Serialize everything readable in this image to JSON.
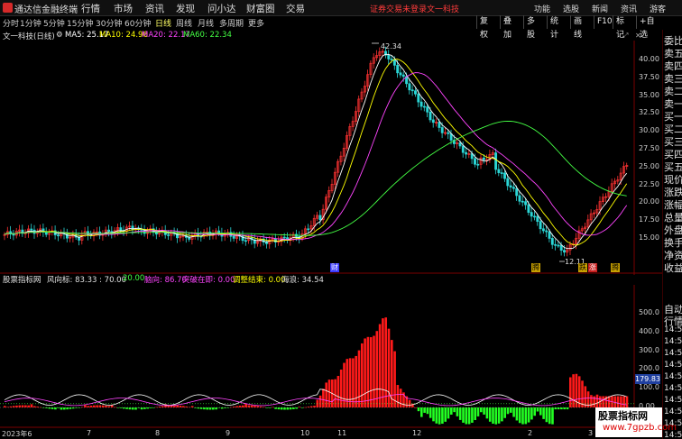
{
  "app": {
    "name": "通达信金融终端",
    "menus": [
      "行情",
      "市场",
      "资讯",
      "发现",
      "问小达",
      "财富圈",
      "交易"
    ],
    "warning": "证券交易未登录",
    "stock_title": "文一科技",
    "right_menus": [
      "功能",
      "选股",
      "新闻",
      "资讯",
      "游客"
    ]
  },
  "periods": {
    "items": [
      "分时",
      "1分钟",
      "5分钟",
      "15分钟",
      "30分钟",
      "60分钟",
      "日线",
      "周线",
      "月线",
      "多周期",
      "更多"
    ],
    "active": "日线"
  },
  "toolbar": {
    "buttons": [
      "复权",
      "叠加",
      "多股",
      "统计",
      "画线",
      "F10",
      "标记",
      "+自选"
    ]
  },
  "info": {
    "stock": "文一科技(日线)",
    "ma5": "MA5: 25.17",
    "ma10": "MA10: 24.96",
    "ma20": "MA20: 22.17",
    "ma60": "MA60: 22.34"
  },
  "price_axis": [
    "40.00",
    "37.50",
    "35.00",
    "32.50",
    "30.00",
    "27.50",
    "25.00",
    "22.50",
    "20.00",
    "17.50",
    "15.00"
  ],
  "annotations": {
    "high": "42.34",
    "low": "12.11",
    "tag_cai": "财",
    "tag_ju": "腾",
    "tag_tuo": "跌",
    "tag_zhang": "涨",
    "tag_teng": "腾"
  },
  "indicator": {
    "name": "股票指标网",
    "fengxiang": "风向标: 83.33 : 70.00",
    "v20": "20.00",
    "ling": "脑向: 86.70",
    "tupo": "突破在即: 0.00",
    "tiaozheng": "调整结束: 0.00",
    "hailang": "海浪: 34.54"
  },
  "ind_axis": [
    "500.0",
    "400.0",
    "300.0",
    "200.0",
    "100.0",
    "0.00"
  ],
  "current_value": "179.83",
  "x_axis": [
    "2023年6",
    "7",
    "8",
    "9",
    "10",
    "11",
    "12",
    "2",
    "3"
  ],
  "right_panel": {
    "rows": [
      "委比",
      "卖五",
      "卖四",
      "卖三",
      "卖二",
      "卖一",
      "买一",
      "买二",
      "买三",
      "买四",
      "买五",
      "现价",
      "涨跌",
      "涨幅",
      "总量",
      "外盘",
      "换手",
      "净资",
      "收益"
    ],
    "rows2": [
      "自动",
      "行情",
      "14:50",
      "14:50",
      "14:50",
      "14:50",
      "14:50",
      "14:50",
      "14:50",
      "14:50",
      "14:50",
      "14:50"
    ]
  },
  "watermark": {
    "line1": "股票指标网",
    "line2": "www.7gpzb.com"
  },
  "colors": {
    "up": "#ff3232",
    "down": "#2bd6d6",
    "ma5": "#ffffff",
    "ma10": "#ffff00",
    "ma20": "#ff44ff",
    "ma60": "#44ff44",
    "ind_pos": "#ff1a1a",
    "ind_neg": "#22ff22"
  }
}
